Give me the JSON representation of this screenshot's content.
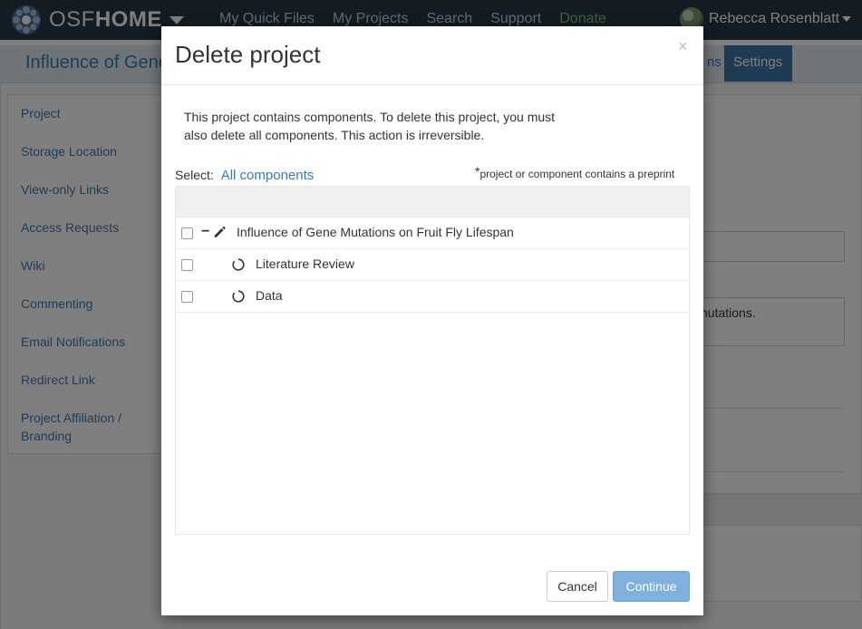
{
  "navbar": {
    "brand_light": "OSF",
    "brand_bold": "HOME",
    "links": [
      "My Quick Files",
      "My Projects",
      "Search",
      "Support",
      "Donate"
    ],
    "user_name": "Rebecca Rosenblatt"
  },
  "subnav": {
    "project_title": "Influence of Gene",
    "partial_tab": "ns",
    "settings_tab": "Settings"
  },
  "sidebar": {
    "items": [
      "Project",
      "Storage Location",
      "View-only Links",
      "Access Requests",
      "Wiki",
      "Commenting",
      "Email Notifications",
      "Redirect Link",
      "Project Affiliation /",
      "Branding"
    ]
  },
  "background": {
    "textarea_text": "nutations."
  },
  "modal": {
    "title": "Delete project",
    "close": "×",
    "description_line1": "This project contains components. To delete this project, you must",
    "description_line2": "also delete all components. This action is irreversible.",
    "select_label": "Select:",
    "select_link": "All components",
    "preprint_star": "*",
    "preprint_note": "project or component contains a preprint",
    "tree": [
      {
        "label": "Influence of Gene Mutations on Fruit Fly Lifespan",
        "expander": "−",
        "icon": "pencil-icon"
      },
      {
        "label": "Literature Review",
        "icon": "spinner-icon"
      },
      {
        "label": "Data",
        "icon": "spinner-icon"
      }
    ],
    "cancel": "Cancel",
    "continue": "Continue"
  },
  "colors": {
    "navbar": "#263947",
    "link": "#3a7bb5",
    "settings_tab": "#3f76a6",
    "continue_button": "#7fb0de",
    "donate": "#7fc36a"
  }
}
